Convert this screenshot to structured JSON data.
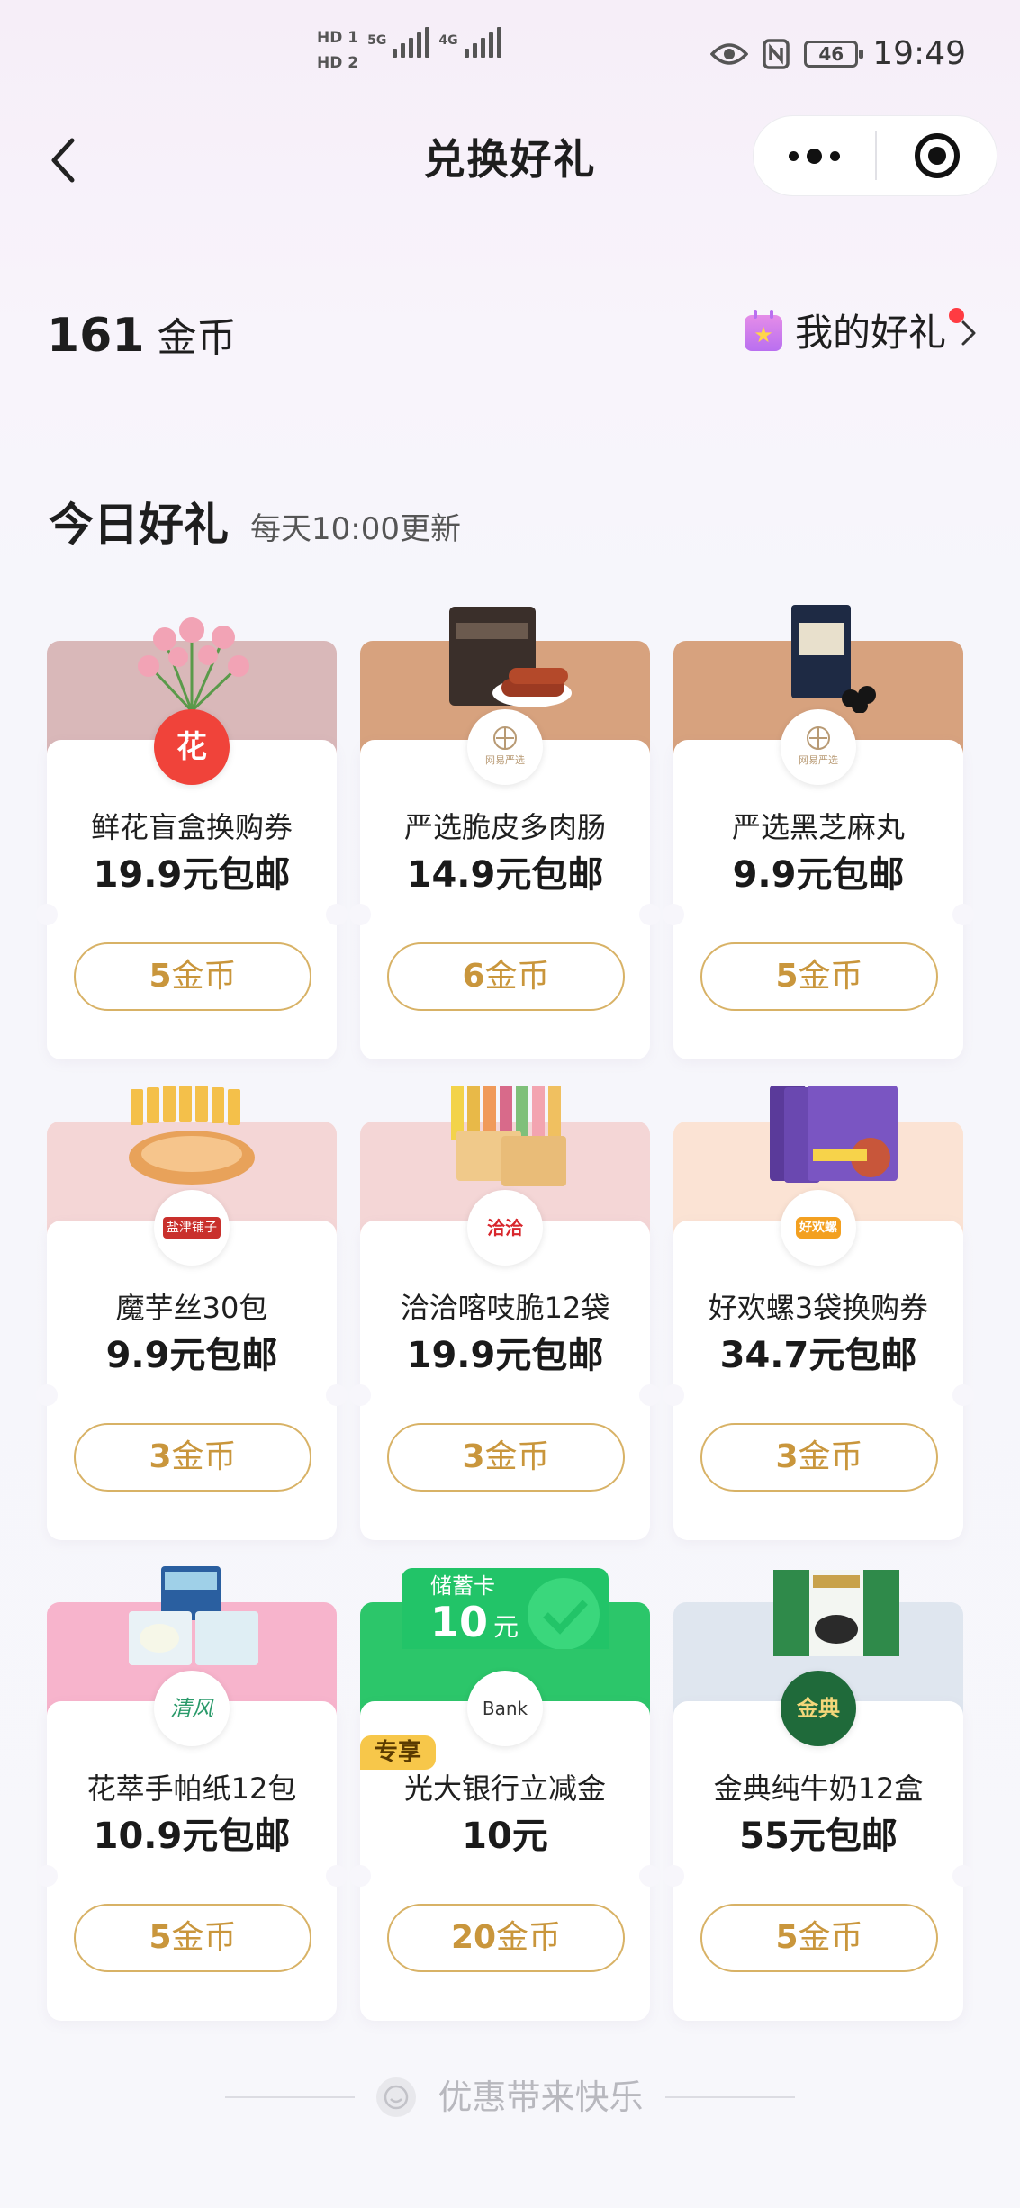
{
  "status_bar": {
    "hd1": "HD 1",
    "hd2": "HD 2",
    "net1": "5G",
    "net2": "4G",
    "battery": "46",
    "time": "19:49"
  },
  "nav": {
    "title": "兑换好礼"
  },
  "wallet": {
    "coins": "161",
    "coins_unit": "金币",
    "my_gifts": "我的好礼"
  },
  "section": {
    "title": "今日好礼",
    "subtitle": "每天10:00更新"
  },
  "products": [
    {
      "name": "鲜花盲盒换购券",
      "price": "19.9元包邮",
      "coins": "5",
      "coin_unit": "金币",
      "logo": "花",
      "top_color": "#d9b8b9"
    },
    {
      "name": "严选脆皮多肉肠",
      "price": "14.9元包邮",
      "coins": "6",
      "coin_unit": "金币",
      "logo": "网易严选",
      "top_color": "#d7a27e"
    },
    {
      "name": "严选黑芝麻丸",
      "price": "9.9元包邮",
      "coins": "5",
      "coin_unit": "金币",
      "logo": "网易严选",
      "top_color": "#d7a27e"
    },
    {
      "name": "魔芋丝30包",
      "price": "9.9元包邮",
      "coins": "3",
      "coin_unit": "金币",
      "logo": "盐津铺子",
      "top_color": "#f4d6d6"
    },
    {
      "name": "洽洽喀吱脆12袋",
      "price": "19.9元包邮",
      "coins": "3",
      "coin_unit": "金币",
      "logo": "洽洽",
      "top_color": "#f4d6d6"
    },
    {
      "name": "好欢螺3袋换购券",
      "price": "34.7元包邮",
      "coins": "3",
      "coin_unit": "金币",
      "logo": "好欢螺",
      "top_color": "#fbe3d4"
    },
    {
      "name": "花萃手帕纸12包",
      "price": "10.9元包邮",
      "coins": "5",
      "coin_unit": "金币",
      "logo": "清风",
      "top_color": "#f7b4cc"
    },
    {
      "name": "光大银行立减金",
      "price": "10元",
      "coins": "20",
      "coin_unit": "金币",
      "logo": "Bank",
      "top_color": "#2cc66a",
      "badge": "专享",
      "card_label": "储蓄卡",
      "card_amount": "10",
      "card_amount_unit": "元"
    },
    {
      "name": "金典纯牛奶12盒",
      "price": "55元包邮",
      "coins": "5",
      "coin_unit": "金币",
      "logo": "金典",
      "top_color": "#dfe6ef"
    }
  ],
  "footer": {
    "text": "优惠带来快乐"
  },
  "colors": {
    "accent_gold": "#c9963c",
    "button_border": "#d8b266",
    "red_dot": "#ff3b42"
  }
}
